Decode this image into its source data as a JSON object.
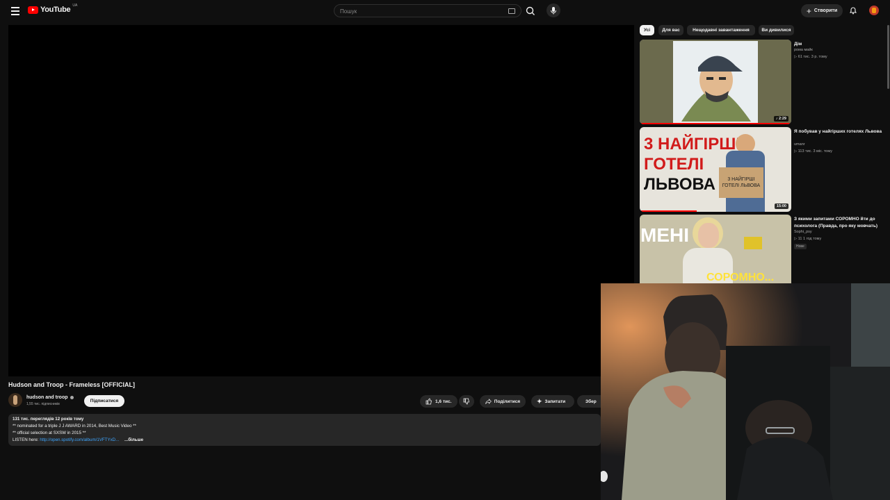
{
  "header": {
    "logo_text": "YouTube",
    "logo_region": "UA",
    "search_placeholder": "Пошук",
    "create_label": "Створити"
  },
  "video": {
    "title": "Hudson and Troop - Frameless [OFFICIAL]",
    "channel_name": "hudson and troop",
    "subscribers": "1,55 тис. підписників",
    "subscribe_label": "Підписатися",
    "like_count": "1,6 тис.",
    "share_label": "Поділитися",
    "ask_label": "Запитати",
    "save_label": "Збер"
  },
  "description": {
    "stats": "131 тис. переглядів  12 років тому",
    "line1": "** nominated for a triple J J AWARD in 2014, Best Music Video **",
    "line2": "** official selection at SXSW in 2015 **",
    "listen_prefix": "LISTEN here:",
    "listen_link": "http://open.spotify.com/album/1VFTYxD...",
    "more_label": "...більше"
  },
  "chips": [
    "Усі",
    "Для вас",
    "Нещодавні завантаження",
    "Ви дивилися"
  ],
  "recommendations": [
    {
      "title": "Дім",
      "channel": "рома майк",
      "meta": "▷ 61 тис.  3 р. тому",
      "duration": "♪ 2:29"
    },
    {
      "title": "Я побував у найгірших готелях Львова",
      "channel": "umanr",
      "meta": "▷ 113 тис.  3 міс. тому",
      "duration": "15:00",
      "thumb_text": {
        "l1": "3 НАЙГІРШІ",
        "l2": "ГОТЕЛІ",
        "l3": "ЛЬВОВА",
        "sign": "3 НАЙГІРШІ ГОТЕЛІ ЛЬВОВА"
      }
    },
    {
      "title": "З якими запитами СОРОМНО йти до психолога (Правда, про яку мовчать)",
      "channel": "Sophi_psy",
      "meta": "▷ 11  1 год тому",
      "badge": "Нове",
      "thumb_text": {
        "top": "МЕНІ",
        "bottom": "СОРОМНО..."
      }
    }
  ],
  "colors": {
    "accent_red": "#ff0000",
    "link_blue": "#3ea6ff",
    "background": "#0f0f0f"
  }
}
